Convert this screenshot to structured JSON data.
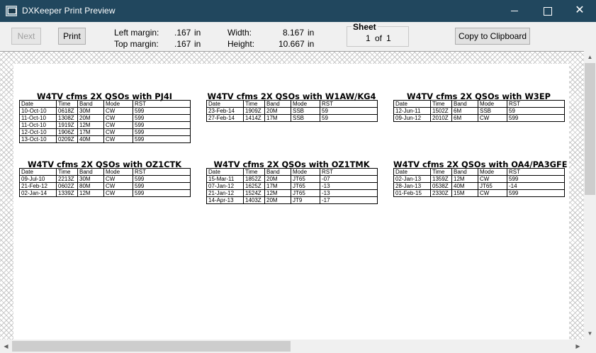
{
  "window": {
    "title": "DXKeeper Print Preview",
    "controls": {
      "minimize": "",
      "maximize": "",
      "close": "✕"
    }
  },
  "toolbar": {
    "next_label": "Next",
    "print_label": "Print",
    "left_margin_label": "Left margin:",
    "left_margin_value": ".167",
    "left_margin_unit": "in",
    "top_margin_label": "Top margin:",
    "top_margin_value": ".167",
    "top_margin_unit": "in",
    "width_label": "Width:",
    "width_value": "8.167",
    "width_unit": "in",
    "height_label": "Height:",
    "height_value": "10.667",
    "height_unit": "in",
    "sheet_title": "Sheet",
    "sheet_current": "1",
    "sheet_of": "of",
    "sheet_total": "1",
    "copy_label": "Copy to Clipboard"
  },
  "scrollbars": {
    "up": "▲",
    "down": "▼",
    "left": "◀",
    "right": "▶"
  },
  "columns": [
    "Date",
    "Time",
    "Band",
    "Mode",
    "RST"
  ],
  "blocks": [
    {
      "title": "W4TV cfms 2X QSOs with PJ4I",
      "rows": [
        [
          "10-Oct-10",
          "0618Z",
          "30M",
          "CW",
          "599"
        ],
        [
          "11-Oct-10",
          "1308Z",
          "20M",
          "CW",
          "599"
        ],
        [
          "11-Oct-10",
          "1919Z",
          "12M",
          "CW",
          "599"
        ],
        [
          "12-Oct-10",
          "1906Z",
          "17M",
          "CW",
          "599"
        ],
        [
          "13-Oct-10",
          "0209Z",
          "40M",
          "CW",
          "599"
        ]
      ]
    },
    {
      "title": "W4TV cfms 2X QSOs with W1AW/KG4",
      "rows": [
        [
          "23-Feb-14",
          "1909Z",
          "20M",
          "SSB",
          "59"
        ],
        [
          "27-Feb-14",
          "1414Z",
          "17M",
          "SSB",
          "59"
        ]
      ]
    },
    {
      "title": "W4TV cfms 2X QSOs with W3EP",
      "rows": [
        [
          "12-Jun-11",
          "1502Z",
          "6M",
          "SSB",
          "59"
        ],
        [
          "09-Jun-12",
          "2010Z",
          "6M",
          "CW",
          "599"
        ]
      ]
    },
    {
      "title": "W4TV cfms 2X QSOs with OZ1CTK",
      "rows": [
        [
          "09-Jul-10",
          "2213Z",
          "30M",
          "CW",
          "599"
        ],
        [
          "21-Feb-12",
          "0602Z",
          "80M",
          "CW",
          "599"
        ],
        [
          "02-Jan-14",
          "1339Z",
          "12M",
          "CW",
          "599"
        ]
      ]
    },
    {
      "title": "W4TV cfms 2X QSOs with OZ1TMK",
      "rows": [
        [
          "15-Mar-11",
          "1852Z",
          "20M",
          "JT65",
          "-07"
        ],
        [
          "07-Jan-12",
          "1625Z",
          "17M",
          "JT65",
          "-13"
        ],
        [
          "21-Jan-12",
          "1524Z",
          "12M",
          "JT65",
          "-13"
        ],
        [
          "14-Apr-13",
          "1403Z",
          "20M",
          "JT9",
          "-17"
        ]
      ]
    },
    {
      "title": "W4TV cfms 2X QSOs with OA4/PA3GFE",
      "rows": [
        [
          "02-Jan-13",
          "1359Z",
          "12M",
          "CW",
          "599"
        ],
        [
          "28-Jan-13",
          "0538Z",
          "40M",
          "JT65",
          "-14"
        ],
        [
          "01-Feb-15",
          "2330Z",
          "15M",
          "CW",
          "599"
        ]
      ]
    }
  ]
}
